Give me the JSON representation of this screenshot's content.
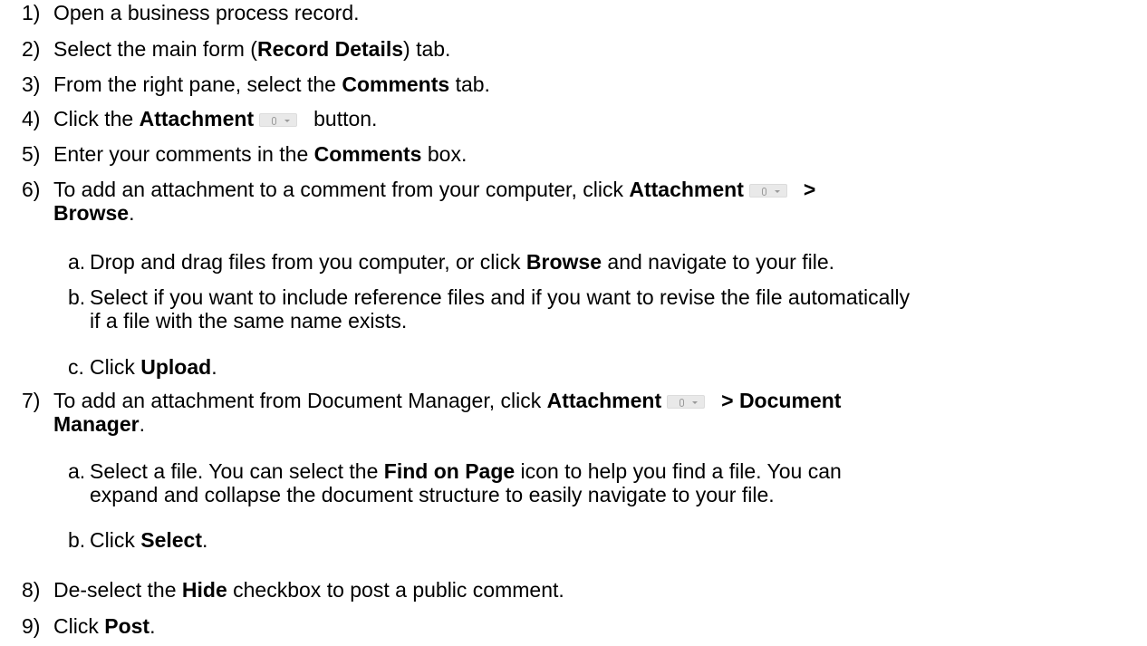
{
  "steps": [
    {
      "num": "1)",
      "parts": [
        {
          "t": "Open a business process record."
        }
      ]
    },
    {
      "num": "2)",
      "parts": [
        {
          "t": "Select the main form ("
        },
        {
          "t": "Record Details",
          "b": true
        },
        {
          "t": ") tab."
        }
      ]
    },
    {
      "num": "3)",
      "parts": [
        {
          "t": "From the right pane, select the "
        },
        {
          "t": "Comments",
          "b": true
        },
        {
          "t": " tab."
        }
      ]
    },
    {
      "num": "4)",
      "parts": [
        {
          "t": "Click the "
        },
        {
          "t": "Attachment",
          "b": true
        },
        {
          "icon": "attachment-icon"
        },
        {
          "t": "button."
        }
      ]
    },
    {
      "num": "5)",
      "parts": [
        {
          "t": "Enter your comments in the "
        },
        {
          "t": "Comments",
          "b": true
        },
        {
          "t": " box."
        }
      ]
    },
    {
      "num": "6)",
      "parts": [
        {
          "t": "To add an attachment to a comment from your computer, click "
        },
        {
          "t": "Attachment",
          "b": true
        },
        {
          "icon": "attachment-icon"
        },
        {
          "t": ">",
          "b": true
        },
        {
          "br": true
        },
        {
          "t": "Browse",
          "b": true
        },
        {
          "t": "."
        }
      ],
      "sub": [
        {
          "letter": "a.",
          "parts": [
            {
              "t": "Drop and drag files from you computer, or click "
            },
            {
              "t": "Browse",
              "b": true
            },
            {
              "t": " and navigate to your file."
            }
          ]
        },
        {
          "letter": "b.",
          "parts": [
            {
              "t": "Select if you want to include reference files and if you want to revise the file automatically"
            },
            {
              "br": true
            },
            {
              "t": "if a file with the same name exists."
            }
          ]
        },
        {
          "letter": "c.",
          "parts": [
            {
              "t": "Click "
            },
            {
              "t": "Upload",
              "b": true
            },
            {
              "t": "."
            }
          ]
        }
      ]
    },
    {
      "num": "7)",
      "parts": [
        {
          "t": "To add an attachment from Document Manager, click "
        },
        {
          "t": "Attachment",
          "b": true
        },
        {
          "icon": "attachment-icon"
        },
        {
          "t": "> Document",
          "b": true
        },
        {
          "br": true
        },
        {
          "t": "Manager",
          "b": true
        },
        {
          "t": "."
        }
      ],
      "sub": [
        {
          "letter": "a.",
          "parts": [
            {
              "t": "Select a file. You can select the "
            },
            {
              "t": "Find on Page",
              "b": true
            },
            {
              "t": " icon to help you find a file. You can"
            },
            {
              "br": true
            },
            {
              "t": "expand and collapse the document structure to easily navigate to your file."
            }
          ]
        },
        {
          "letter": "b.",
          "parts": [
            {
              "t": "Click "
            },
            {
              "t": "Select",
              "b": true
            },
            {
              "t": "."
            }
          ]
        }
      ]
    },
    {
      "num": "8)",
      "parts": [
        {
          "t": "De-select the "
        },
        {
          "t": "Hide",
          "b": true
        },
        {
          "t": " checkbox to post a public comment."
        }
      ]
    },
    {
      "num": "9)",
      "parts": [
        {
          "t": "Click "
        },
        {
          "t": "Post",
          "b": true
        },
        {
          "t": "."
        }
      ]
    }
  ]
}
